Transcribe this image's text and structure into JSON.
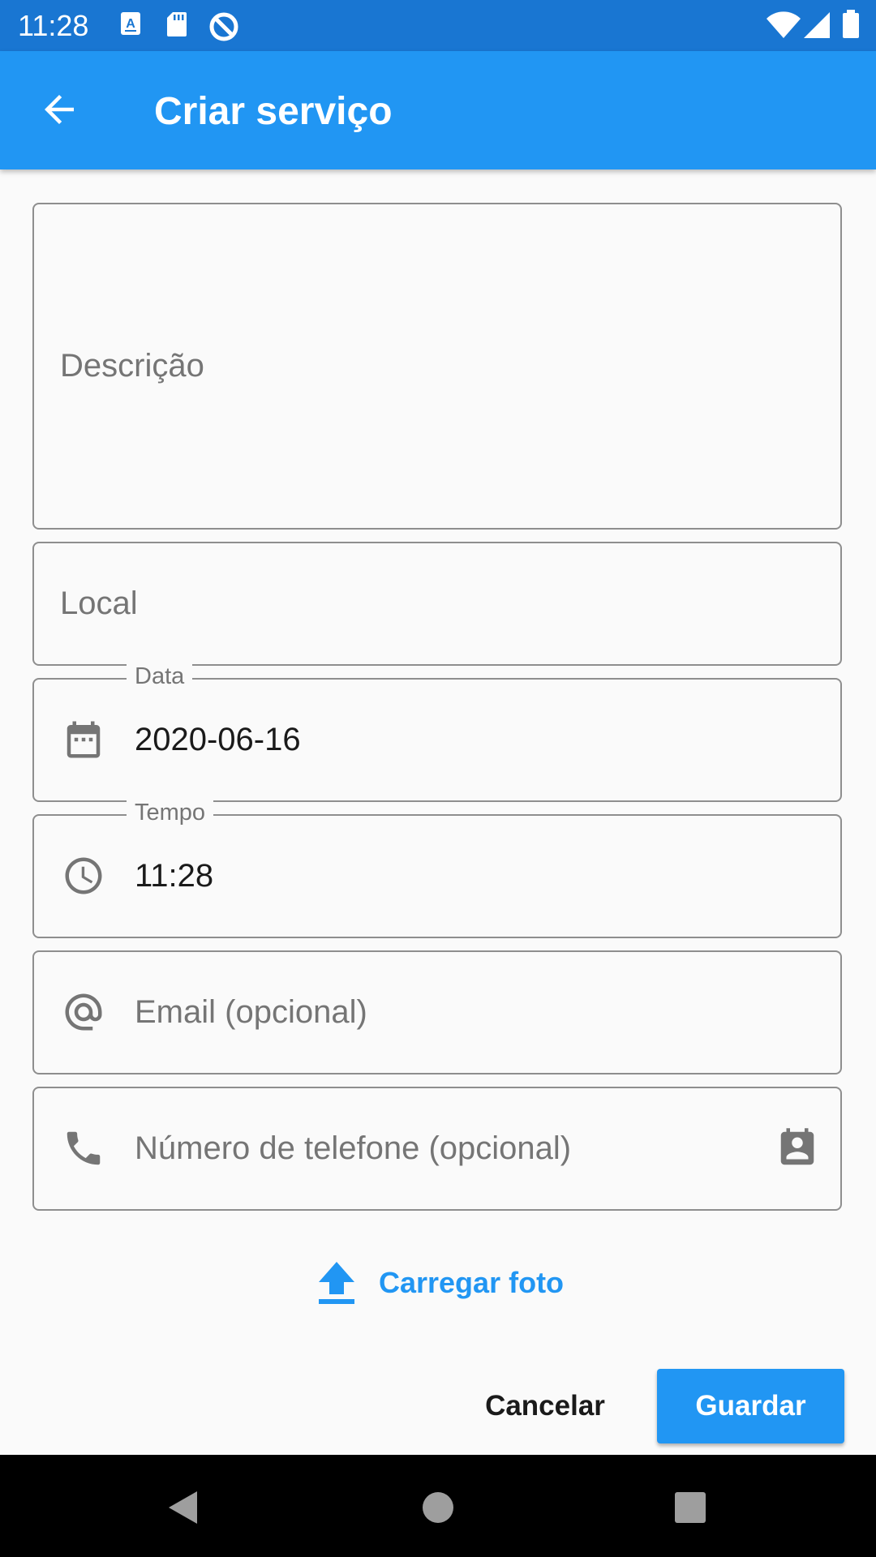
{
  "status_bar": {
    "time": "11:28",
    "left_icons": [
      "keyboard-a-icon",
      "sd-card-icon",
      "no-sync-icon"
    ],
    "right_icons": [
      "wifi-icon",
      "signal-icon",
      "battery-icon"
    ]
  },
  "app_bar": {
    "back_icon": "arrow-back-icon",
    "title": "Criar serviço",
    "color": "#2196f3"
  },
  "form": {
    "description": {
      "placeholder": "Descrição",
      "value": ""
    },
    "location": {
      "placeholder": "Local",
      "value": ""
    },
    "date": {
      "label": "Data",
      "value": "2020-06-16",
      "icon": "calendar-icon"
    },
    "time": {
      "label": "Tempo",
      "value": "11:28",
      "icon": "clock-icon"
    },
    "email": {
      "placeholder": "Email (opcional)",
      "value": "",
      "icon": "at-sign-icon"
    },
    "phone": {
      "placeholder": "Número de telefone (opcional)",
      "value": "",
      "icon": "phone-icon",
      "trailing_icon": "contact-card-icon"
    }
  },
  "upload": {
    "label": "Carregar foto",
    "icon": "upload-icon"
  },
  "actions": {
    "cancel_label": "Cancelar",
    "save_label": "Guardar"
  },
  "nav_bar": {
    "items": [
      "back-triangle-icon",
      "home-circle-icon",
      "recents-square-icon"
    ]
  }
}
